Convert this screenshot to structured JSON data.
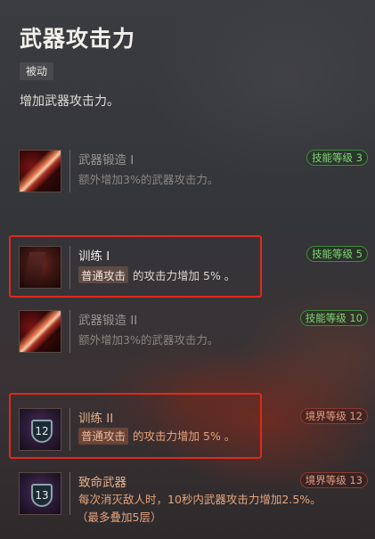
{
  "skill": {
    "title": "武器攻击力",
    "type": "被动",
    "description": "增加武器攻击力。"
  },
  "rows": [
    {
      "name": "武器锻造 I",
      "desc": "额外增加3%的武器攻击力。",
      "tag": "技能等级 3",
      "tag_color": "#7fd673"
    },
    {
      "name": "训练 I",
      "highlight": "普通攻击",
      "desc": "的攻击力增加 5% 。",
      "tag": "技能等级 5",
      "tag_color": "#7fd673"
    },
    {
      "name": "武器锻造 II",
      "desc": "额外增加3%的武器攻击力。",
      "tag": "技能等级 10",
      "tag_color": "#7fd673"
    },
    {
      "name": "训练 II",
      "icon_number": "12",
      "highlight": "普通攻击",
      "desc": "的攻击力增加 5% 。",
      "tag": "境界等级 12",
      "tag_color": "#e89a80"
    },
    {
      "name": "致命武器",
      "icon_number": "13",
      "desc_line1": "每次消灭敌人时，10秒内武器攻击力增加2.5%。",
      "desc_line2": "（最多叠加5层）",
      "tag": "境界等级 13",
      "tag_color": "#e89a80"
    }
  ],
  "colors": {
    "selection_outline": "#e0291f"
  }
}
